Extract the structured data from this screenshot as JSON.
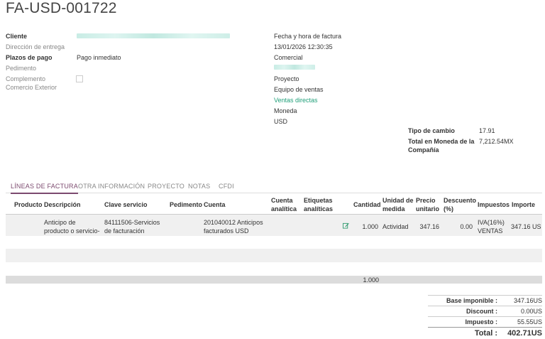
{
  "invoice": {
    "title": "FA-USD-001722"
  },
  "left_fields": {
    "cliente_label": "Cliente",
    "direccion_label": "Dirección de entrega",
    "plazos_label": "Plazos de pago",
    "plazos_value": "Pago inmediato",
    "pedimento_label": "Pedimento",
    "complemento_label_1": "Complemento",
    "complemento_label_2": "Comercio Exterior"
  },
  "right_fields": {
    "fecha_label": "Fecha y hora de factura",
    "fecha_value": "13/01/2026 12:30:35",
    "comercial_label": "Comercial",
    "proyecto_label": "Proyecto",
    "equipo_label": "Equipo de ventas",
    "equipo_value": "Ventas directas",
    "moneda_label": "Moneda",
    "moneda_value": "USD",
    "tipo_cambio_label": "Tipo de cambio",
    "tipo_cambio_value": "17.91",
    "total_moneda_label_1": "Total en Moneda de la",
    "total_moneda_label_2": "Compañía",
    "total_moneda_value": "7,212.54MX"
  },
  "tabs": [
    "LÍNEAS DE FACTURA",
    "OTRA INFORMACIÓN",
    "PROYECTO",
    "NOTAS",
    "CFDI"
  ],
  "table": {
    "headers": {
      "producto": "Producto",
      "descripcion": "Descripción",
      "clave": "Clave servicio",
      "pedimento": "Pedimento",
      "cuenta": "Cuenta",
      "cuenta_analitica_1": "Cuenta",
      "cuenta_analitica_2": "analítica",
      "etiquetas_1": "Etiquetas",
      "etiquetas_2": "analíticas",
      "cantidad": "Cantidad",
      "unidad_1": "Unidad de",
      "unidad_2": "medida",
      "precio_1": "Precio",
      "precio_2": "unitario",
      "descuento_1": "Descuento",
      "descuento_2": "(%)",
      "impuestos": "Impuestos",
      "importe": "Importe"
    },
    "row": {
      "descripcion_1": "Anticipo de",
      "descripcion_2": "producto o servicio-",
      "clave_1": "84111506-Servicios",
      "clave_2": "de facturación",
      "cuenta_1": "201040012 Anticipos",
      "cuenta_2": "facturados USD",
      "cantidad": "1.000",
      "unidad": "Actividad",
      "precio": "347.16",
      "descuento": "0.00",
      "impuestos_1": "IVA(16%)",
      "impuestos_2": "VENTAS",
      "importe": "347.16 US"
    },
    "footer_cantidad": "1.000"
  },
  "totals": {
    "base_label": "Base imponible :",
    "base_value": "347.16US",
    "discount_label": "Discount :",
    "discount_value": "0.00US",
    "impuesto_label": "Impuesto :",
    "impuesto_value": "55.55US",
    "total_label": "Total :",
    "total_value": "402.71US"
  }
}
